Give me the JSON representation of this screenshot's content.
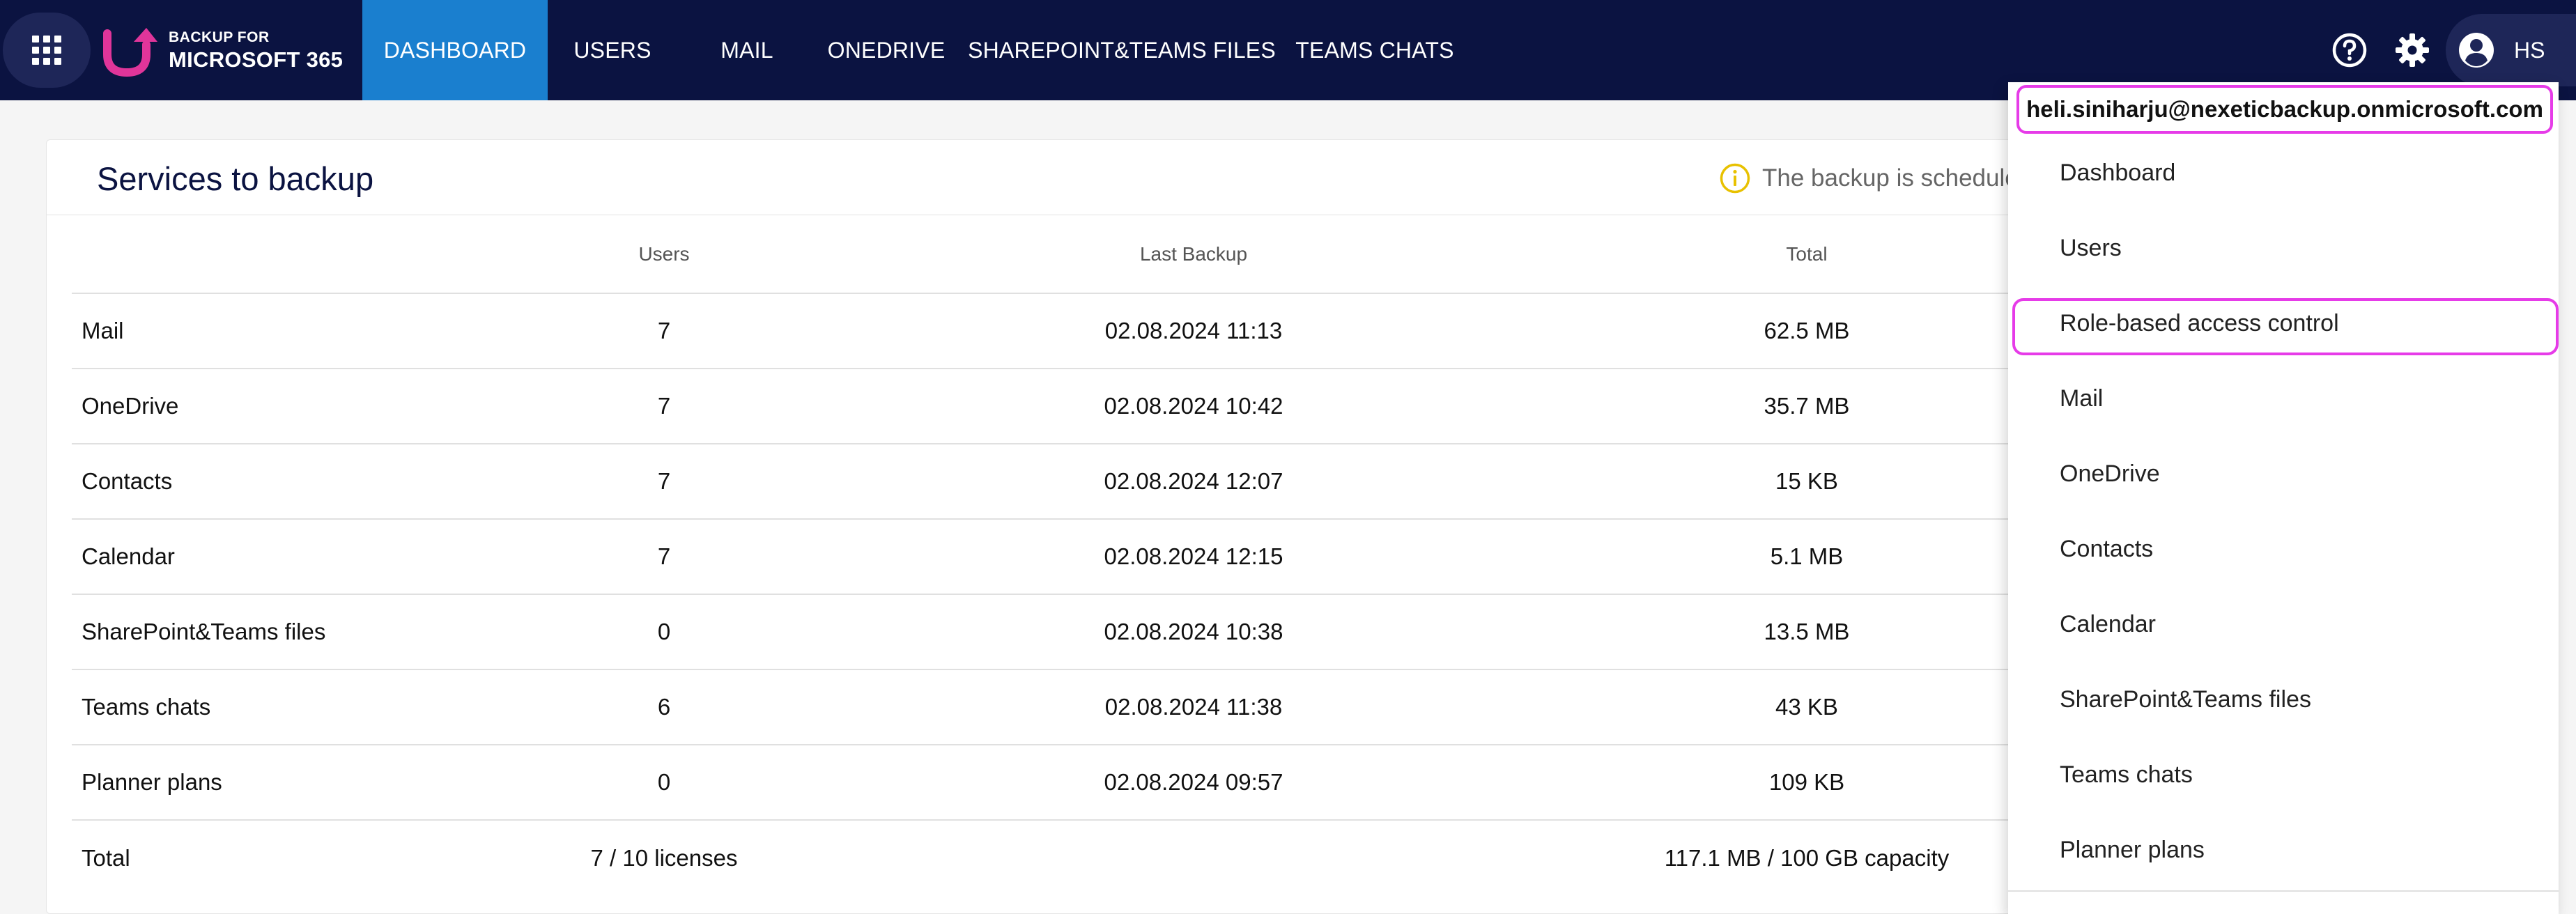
{
  "header": {
    "logo": {
      "line1": "BACKUP FOR",
      "line2": "MICROSOFT 365"
    },
    "nav": [
      {
        "label": "DASHBOARD",
        "active": true
      },
      {
        "label": "USERS",
        "active": false
      },
      {
        "label": "MAIL",
        "active": false
      },
      {
        "label": "ONEDRIVE",
        "active": false
      },
      {
        "label": "SHAREPOINT&TEAMS FILES",
        "active": false
      },
      {
        "label": "TEAMS CHATS",
        "active": false
      }
    ],
    "icons": [
      "apps-grid-icon",
      "help-icon",
      "settings-icon",
      "account-icon"
    ],
    "user_initials": "HS",
    "colors": {
      "bar": "#0b1341",
      "active_tab": "#1a7fcf",
      "logo_accent": "#e0359a"
    }
  },
  "services_card": {
    "title": "Services to backup",
    "notice": "The backup is schedule",
    "notice_icon": "info-icon",
    "columns": [
      "",
      "Users",
      "Last Backup",
      "Total"
    ],
    "rows": [
      {
        "service": "Mail",
        "users": "7",
        "last_backup": "02.08.2024 11:13",
        "total": "62.5 MB"
      },
      {
        "service": "OneDrive",
        "users": "7",
        "last_backup": "02.08.2024 10:42",
        "total": "35.7 MB"
      },
      {
        "service": "Contacts",
        "users": "7",
        "last_backup": "02.08.2024 12:07",
        "total": "15 KB"
      },
      {
        "service": "Calendar",
        "users": "7",
        "last_backup": "02.08.2024 12:15",
        "total": "5.1 MB"
      },
      {
        "service": "SharePoint&Teams files",
        "users": "0",
        "last_backup": "02.08.2024 10:38",
        "total": "13.5 MB"
      },
      {
        "service": "Teams chats",
        "users": "6",
        "last_backup": "02.08.2024 11:38",
        "total": "43 KB"
      },
      {
        "service": "Planner plans",
        "users": "0",
        "last_backup": "02.08.2024 09:57",
        "total": "109 KB"
      }
    ],
    "total_row": {
      "service": "Total",
      "users": "7 / 10 licenses",
      "last_backup": "",
      "total": "117.1 MB / 100 GB capacity"
    }
  },
  "user_menu": {
    "email": "heli.siniharju@nexeticbackup.onmicrosoft.com",
    "items": [
      "Dashboard",
      "Users",
      "Role-based access control",
      "Mail",
      "OneDrive",
      "Contacts",
      "Calendar",
      "SharePoint&Teams files",
      "Teams chats",
      "Planner plans"
    ],
    "highlight_color": "#e63be8"
  }
}
